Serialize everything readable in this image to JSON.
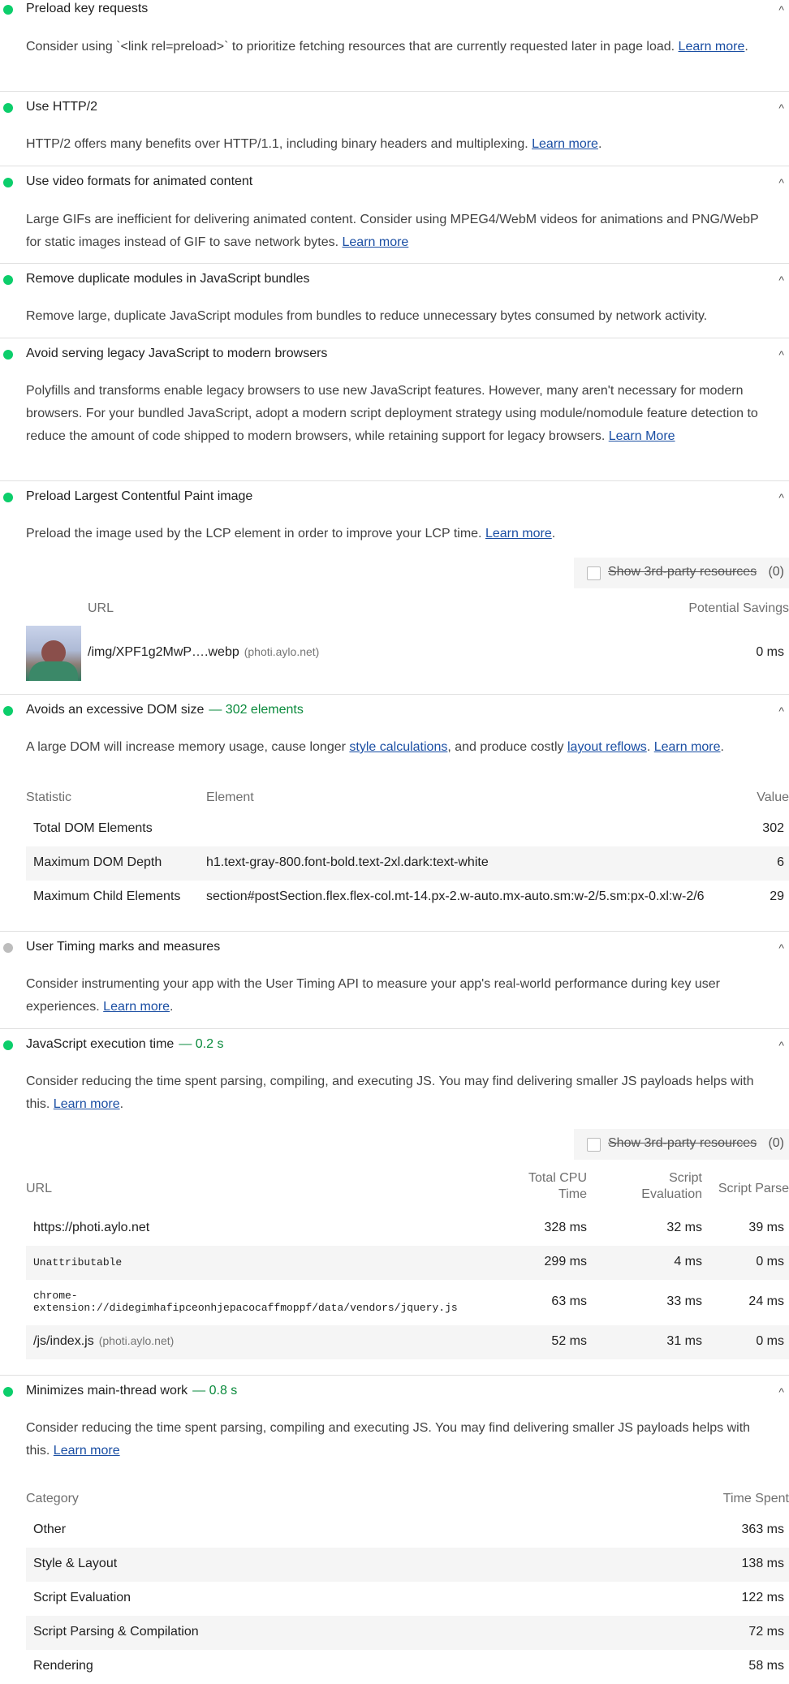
{
  "audits": {
    "preload": {
      "title": "Preload key requests",
      "desc": "Consider using `<link rel=preload>` to prioritize fetching resources that are currently requested later in page load. ",
      "learn": "Learn more"
    },
    "http2": {
      "title": "Use HTTP/2",
      "desc": "HTTP/2 offers many benefits over HTTP/1.1, including binary headers and multiplexing. ",
      "learn": "Learn more"
    },
    "video": {
      "title": "Use video formats for animated content",
      "desc": "Large GIFs are inefficient for delivering animated content. Consider using MPEG4/WebM videos for animations and PNG/WebP for static images instead of GIF to save network bytes. ",
      "learn": "Learn more"
    },
    "dupes": {
      "title": "Remove duplicate modules in JavaScript bundles",
      "desc": "Remove large, duplicate JavaScript modules from bundles to reduce unnecessary bytes consumed by network activity."
    },
    "legacy": {
      "title": "Avoid serving legacy JavaScript to modern browsers",
      "desc": "Polyfills and transforms enable legacy browsers to use new JavaScript features. However, many aren't necessary for modern browsers. For your bundled JavaScript, adopt a modern script deployment strategy using module/nomodule feature detection to reduce the amount of code shipped to modern browsers, while retaining support for legacy browsers. ",
      "learn": "Learn More"
    },
    "lcp": {
      "title": "Preload Largest Contentful Paint image",
      "desc": "Preload the image used by the LCP element in order to improve your LCP time. ",
      "learn": "Learn more",
      "third_label": "Show 3rd-party resources",
      "third_count": "(0)",
      "col_url": "URL",
      "col_savings": "Potential Savings",
      "row": {
        "url": "/img/XPF1g2MwP….webp",
        "host": "(photi.aylo.net)",
        "savings": "0 ms"
      }
    },
    "dom": {
      "title": "Avoids an excessive DOM size",
      "disp": "— 302 elements",
      "desc_a": "A large DOM will increase memory usage, cause longer ",
      "link1": "style calculations",
      "desc_b": ", and produce costly ",
      "link2": "layout reflows",
      "desc_c": ". ",
      "learn": "Learn more",
      "desc_d": ".",
      "col_stat": "Statistic",
      "col_el": "Element",
      "col_val": "Value",
      "rows": [
        {
          "stat": "Total DOM Elements",
          "el": "",
          "val": "302"
        },
        {
          "stat": "Maximum DOM Depth",
          "el": "h1.text-gray-800.font-bold.text-2xl.dark:text-white",
          "val": "6"
        },
        {
          "stat": "Maximum Child Elements",
          "el": "section#postSection.flex.flex-col.mt-14.px-2.w-auto.mx-auto.sm:w-2/5.sm:px-0.xl:w-2/6",
          "val": "29"
        }
      ]
    },
    "timing": {
      "title": "User Timing marks and measures",
      "desc": "Consider instrumenting your app with the User Timing API to measure your app's real-world performance during key user experiences. ",
      "learn": "Learn more"
    },
    "js": {
      "title": "JavaScript execution time",
      "disp": "— 0.2 s",
      "desc": "Consider reducing the time spent parsing, compiling, and executing JS. You may find delivering smaller JS payloads helps with this. ",
      "learn": "Learn more",
      "third_label": "Show 3rd-party resources",
      "third_count": "(0)",
      "col_url": "URL",
      "col_cpu_1": "Total CPU",
      "col_cpu_2": "Time",
      "col_eval_1": "Script",
      "col_eval_2": "Evaluation",
      "col_parse": "Script Parse",
      "rows": [
        {
          "url": "https://photi.aylo.net",
          "host": "",
          "cpu": "328 ms",
          "eval": "32 ms",
          "parse": "39 ms"
        },
        {
          "url": "Unattributable",
          "host": "",
          "cpu": "299 ms",
          "eval": "4 ms",
          "parse": "0 ms"
        },
        {
          "url": "chrome-",
          "url2": "extension://didegimhafipceonhjepacocaffmoppf/data/vendors/jquery.js",
          "host": "",
          "cpu": "63 ms",
          "eval": "33 ms",
          "parse": "24 ms"
        },
        {
          "url": "/js/index.js",
          "host": "(photi.aylo.net)",
          "cpu": "52 ms",
          "eval": "31 ms",
          "parse": "0 ms"
        }
      ]
    },
    "main": {
      "title": "Minimizes main-thread work",
      "disp": "— 0.8 s",
      "desc": "Consider reducing the time spent parsing, compiling and executing JS. You may find delivering smaller JS payloads helps with this. ",
      "learn": "Learn more",
      "col_cat": "Category",
      "col_time": "Time Spent",
      "rows": [
        {
          "cat": "Other",
          "time": "363 ms"
        },
        {
          "cat": "Style & Layout",
          "time": "138 ms"
        },
        {
          "cat": "Script Evaluation",
          "time": "122 ms"
        },
        {
          "cat": "Script Parsing & Compilation",
          "time": "72 ms"
        },
        {
          "cat": "Rendering",
          "time": "58 ms"
        }
      ]
    }
  },
  "icons": {
    "chevron": "^",
    "status_pass_color": "#0cce6b",
    "status_info_color": "#bdbdbd"
  }
}
